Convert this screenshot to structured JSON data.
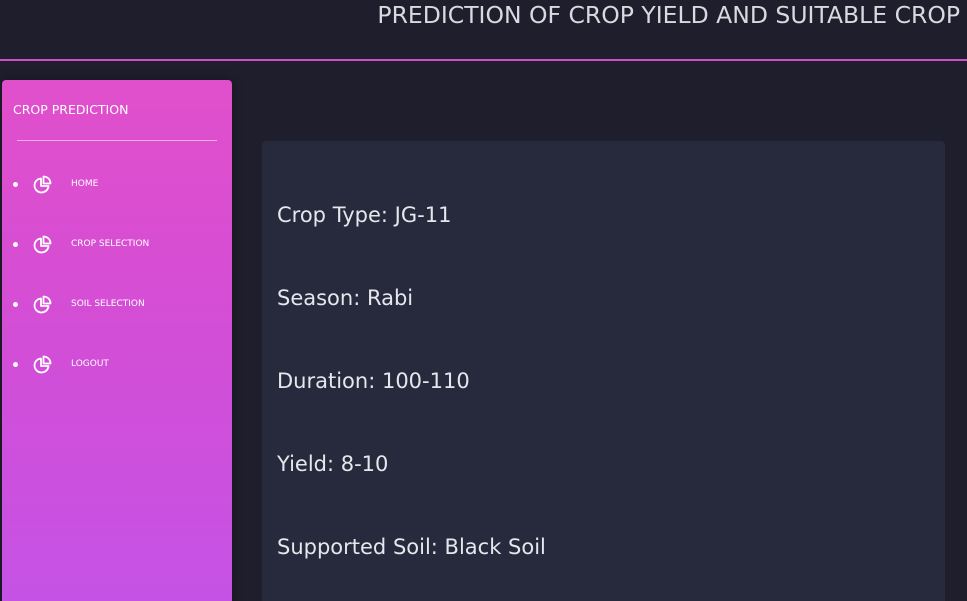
{
  "header": {
    "title": "PREDICTION OF CROP YIELD AND SUITABLE CROP"
  },
  "sidebar": {
    "brand": "CROP PREDICTION",
    "items": [
      {
        "label": "HOME",
        "icon": "pie-chart-icon"
      },
      {
        "label": "CROP SELECTION",
        "icon": "pie-chart-icon"
      },
      {
        "label": "SOIL SELECTION",
        "icon": "pie-chart-icon"
      },
      {
        "label": "LOGOUT",
        "icon": "pie-chart-icon"
      }
    ]
  },
  "crop_info": {
    "crop_type": "Crop Type: JG-11",
    "season": "Season: Rabi",
    "duration": "Duration: 100-110",
    "yield": "Yield: 8-10",
    "supported_soil": "Supported Soil: Black Soil"
  },
  "colors": {
    "background": "#1f1e2c",
    "card": "#272a3d",
    "accent": "#d64bc8",
    "sidebar_top": "#e14fcb",
    "sidebar_bottom": "#c553e6",
    "text": "#e6e6ec"
  }
}
